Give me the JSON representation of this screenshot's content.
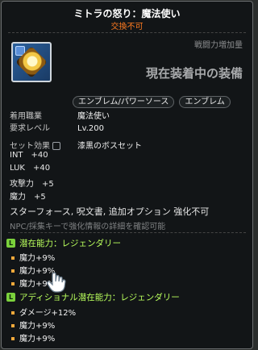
{
  "item": {
    "title": "ミトラの怒り：魔法使い",
    "subtitle": "交換不可",
    "power_label": "戦闘力増加量",
    "equipped_label": "現在装着中の装備",
    "tags": [
      "エンブレム/パワーソース",
      "エンブレム"
    ]
  },
  "requirements": [
    {
      "label": "着用職業",
      "value": "魔法使い"
    },
    {
      "label": "要求レベル",
      "value": "Lv.200"
    }
  ],
  "set": {
    "label": "セット効果",
    "name": "漆黒のボスセット",
    "stats": [
      {
        "name": "INT",
        "value": "+40"
      },
      {
        "name": "LUK",
        "value": "+40"
      },
      {
        "name": "攻撃力",
        "value": "+5"
      },
      {
        "name": "魔力",
        "value": "+5"
      }
    ]
  },
  "notices": {
    "line1": "スターフォース, 呪文書, 追加オプション 強化不可",
    "line2": "NPC/採集キーで強化情報の詳細を確認可能"
  },
  "potential": {
    "badge": "L",
    "title": "潜在能力：レジェンダリー",
    "lines": [
      "魔力+9%",
      "魔力+9%",
      "魔力+9%"
    ]
  },
  "additional_potential": {
    "badge": "L",
    "title": "アディショナル潜在能力：レジェンダリー",
    "lines": [
      "ダメージ+12%",
      "魔力+9%",
      "魔力+9%"
    ]
  },
  "colors": {
    "title": "#ffffff",
    "subtitle": "#ff7b20",
    "potential": "#b9ff5c",
    "badge": "#7bd13c"
  }
}
